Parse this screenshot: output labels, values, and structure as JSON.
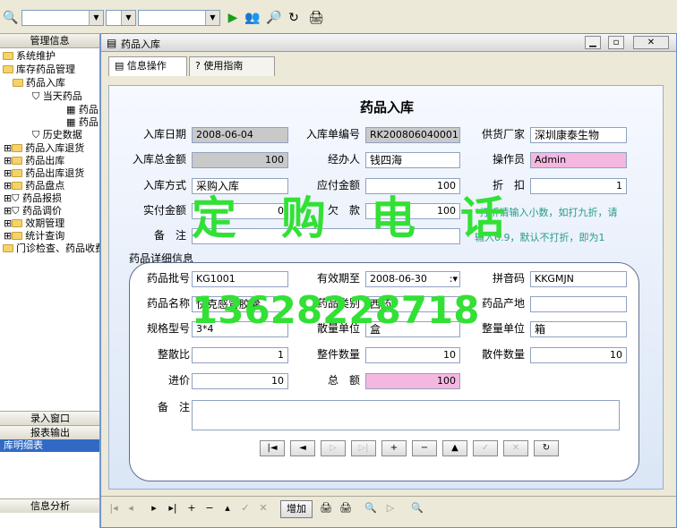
{
  "toolbar": {
    "combo1": "",
    "combo2": "",
    "combo3": "",
    "play_icon": "play-icon"
  },
  "sidebar": {
    "header": "管理信息",
    "items": [
      "系统维护",
      "库存药品管理",
      "药品入库",
      "当天药品",
      "药品",
      "药品",
      "历史数据",
      "药品入库退货",
      "药品出库",
      "药品出库退货",
      "药品盘点",
      "药品报损",
      "药品调价",
      "效期管理",
      "统计查询",
      "门诊检查、药品收费"
    ],
    "entry_button": "录入窗口",
    "report_button": "报表输出",
    "selected": "库明细表",
    "analysis": "信息分析"
  },
  "window": {
    "title": "药品入库",
    "tabs": [
      "信息操作",
      "使用指南"
    ],
    "form_title": "药品入库",
    "fields": {
      "date_label": "入库日期",
      "date": "2008-06-04",
      "order_no_label": "入库单编号",
      "order_no": "RK200806040001",
      "supplier_label": "供货厂家",
      "supplier": "深圳康泰生物",
      "total_label": "入库总金额",
      "total": "100",
      "handler_label": "经办人",
      "handler": "钱四海",
      "operator_label": "操作员",
      "operator": "Admin",
      "method_label": "入库方式",
      "method": "采购入库",
      "payable_label": "应付金额",
      "payable": "100",
      "discount_label": "折　扣",
      "discount": "1",
      "paid_label": "实付金额",
      "paid": "0",
      "owed_label": "欠　款",
      "owed": "100",
      "note_label": "备　注",
      "note": "",
      "hint1": "*打折请输入小数，如打九折，请",
      "hint2": "输入0.9，默认不打折，即为1"
    },
    "detail": {
      "section_label": "药品详细信息",
      "batch_label": "药品批号",
      "batch": "KG1001",
      "expiry_label": "有效期至",
      "expiry": "2008-06-30",
      "pinyin_label": "拼音码",
      "pinyin": "KKGMJN",
      "name_label": "药品名称",
      "name": "快克感冒胶囊",
      "category_label": "药品类别",
      "category": "西药",
      "origin_label": "药品产地",
      "origin": "",
      "spec_label": "规格型号",
      "spec": "3*4",
      "bulk_unit_label": "散量单位",
      "bulk_unit": "盒",
      "whole_unit_label": "整量单位",
      "whole_unit": "箱",
      "ratio_label": "整散比",
      "ratio": "1",
      "whole_qty_label": "整件数量",
      "whole_qty": "10",
      "bulk_qty_label": "散件数量",
      "bulk_qty": "10",
      "price_label": "进价",
      "price": "10",
      "sum_label": "总　额",
      "sum": "100",
      "note_label": "备　注",
      "note": ""
    },
    "nav": [
      "|◄",
      "◄",
      "▷",
      "▷|",
      "+",
      "−",
      "▲",
      "✓",
      "✕",
      "↻"
    ],
    "status": {
      "add": "增加"
    }
  },
  "watermark": {
    "text1": "定　购　电　话",
    "text2": "13628228718"
  },
  "colors": {
    "watermark": "#33e036",
    "operator_bg": "#f4b8e0",
    "hint": "#2a9a8a"
  }
}
